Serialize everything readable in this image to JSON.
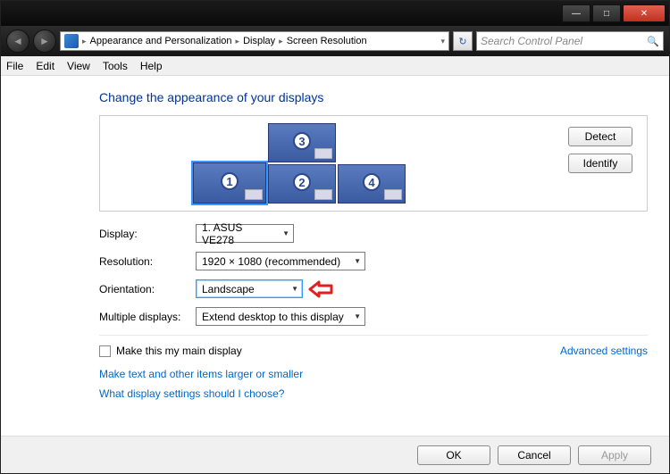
{
  "titlebar": {
    "minimize": "—",
    "maximize": "□",
    "close": "✕"
  },
  "nav": {
    "back": "◄",
    "forward": "►",
    "crumb1": "Appearance and Personalization",
    "crumb2": "Display",
    "crumb3": "Screen Resolution",
    "refresh": "↻",
    "search_placeholder": "Search Control Panel",
    "search_icon": "🔍"
  },
  "menu": {
    "file": "File",
    "edit": "Edit",
    "view": "View",
    "tools": "Tools",
    "help": "Help"
  },
  "content": {
    "heading": "Change the appearance of your displays",
    "detect": "Detect",
    "identify": "Identify",
    "monitors": [
      {
        "num": "1"
      },
      {
        "num": "2"
      },
      {
        "num": "3"
      },
      {
        "num": "4"
      }
    ],
    "labels": {
      "display": "Display:",
      "resolution": "Resolution:",
      "orientation": "Orientation:",
      "multiple": "Multiple displays:"
    },
    "values": {
      "display": "1. ASUS VE278",
      "resolution": "1920 × 1080 (recommended)",
      "orientation": "Landscape",
      "multiple": "Extend desktop to this display"
    },
    "main_display_label": "Make this my main display",
    "advanced": "Advanced settings",
    "link_text_size": "Make text and other items larger or smaller",
    "link_help": "What display settings should I choose?"
  },
  "footer": {
    "ok": "OK",
    "cancel": "Cancel",
    "apply": "Apply"
  }
}
